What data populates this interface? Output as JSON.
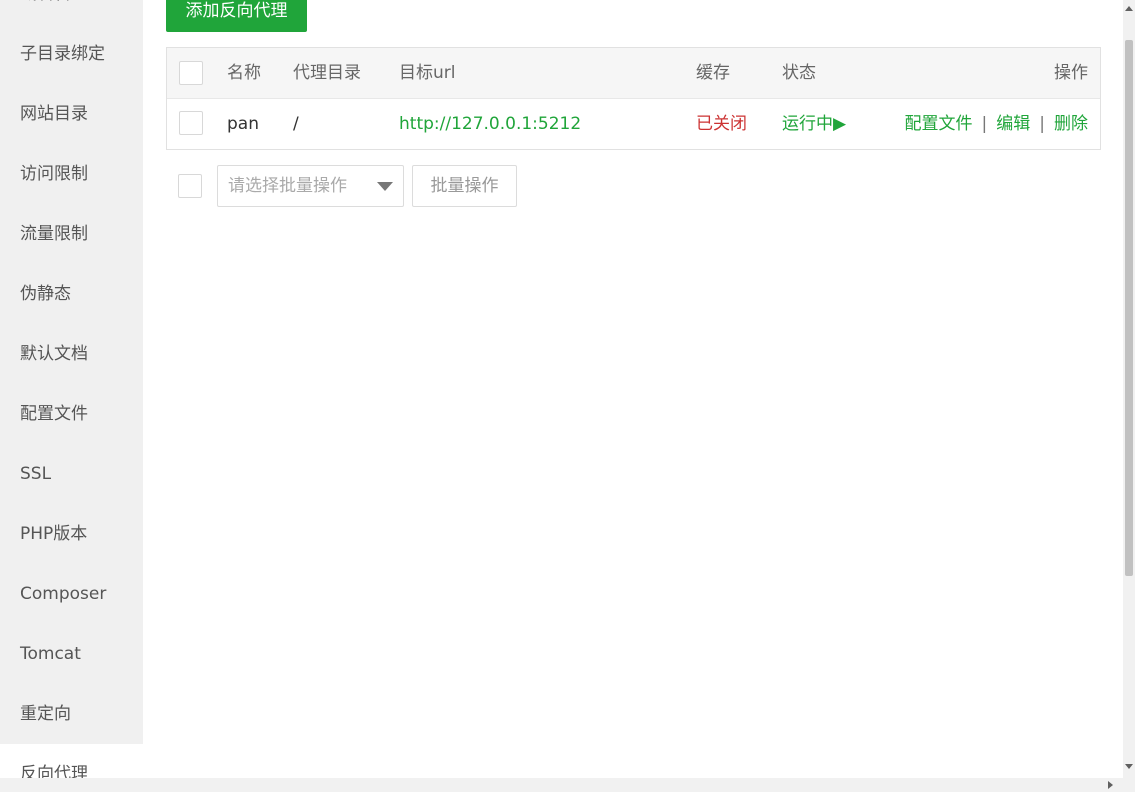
{
  "sidebar": {
    "items": [
      {
        "label": "域名管理"
      },
      {
        "label": "子目录绑定"
      },
      {
        "label": "网站目录"
      },
      {
        "label": "访问限制"
      },
      {
        "label": "流量限制"
      },
      {
        "label": "伪静态"
      },
      {
        "label": "默认文档"
      },
      {
        "label": "配置文件"
      },
      {
        "label": "SSL"
      },
      {
        "label": "PHP版本"
      },
      {
        "label": "Composer"
      },
      {
        "label": "Tomcat"
      },
      {
        "label": "重定向"
      },
      {
        "label": "反向代理"
      }
    ],
    "active_index": 13
  },
  "toolbar": {
    "add_label": "添加反向代理"
  },
  "table": {
    "headers": {
      "name": "名称",
      "proxy_dir": "代理目录",
      "target_url": "目标url",
      "cache": "缓存",
      "status": "状态",
      "actions": "操作"
    },
    "rows": [
      {
        "name": "pan",
        "proxy_dir": "/",
        "target_url": "http://127.0.0.1:5212",
        "cache": "已关闭",
        "status": "运行中",
        "status_icon": "play-icon",
        "actions": {
          "config": "配置文件",
          "edit": "编辑",
          "delete": "删除",
          "separator": "|"
        }
      }
    ]
  },
  "batch": {
    "select_placeholder": "请选择批量操作",
    "button_label": "批量操作"
  },
  "colors": {
    "accent": "#20a53a",
    "danger": "#cc3333"
  }
}
